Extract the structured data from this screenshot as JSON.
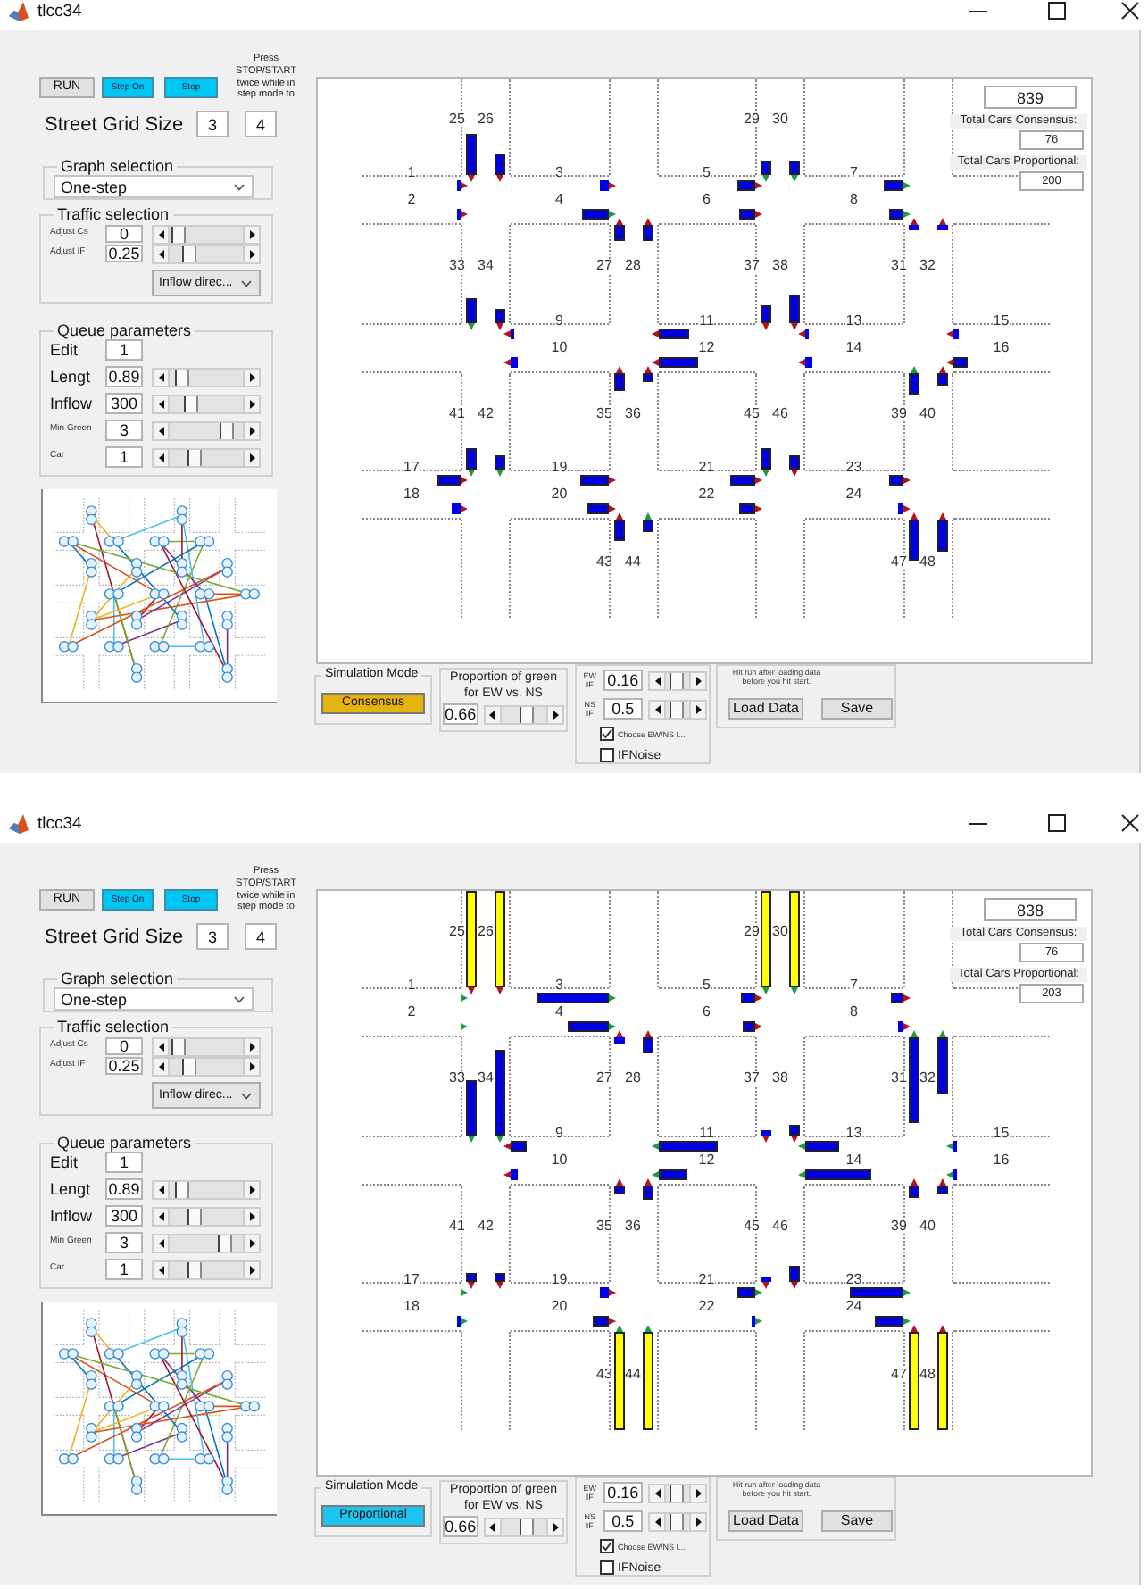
{
  "windows": [
    {
      "title": "tlcc34",
      "run_button": "RUN",
      "step_buttons": [
        "Step On",
        "Stop"
      ],
      "instruction": "Press STOP/START twice while in step mode to",
      "grid_size": {
        "label": "Street Grid Size",
        "rows": "3",
        "columns": "4"
      },
      "graph_selection": {
        "title": "Graph selection",
        "value": "One-step"
      },
      "traffic_selection": {
        "title": "Traffic selection",
        "rows": [
          {
            "label": "Adjust Cs",
            "value": "0",
            "level": 0.02
          },
          {
            "label": "Adjust IF",
            "value": "0.25",
            "level": 0.22
          }
        ],
        "direction": "Inflow direc..."
      },
      "queue_parameters": {
        "title": "Queue parameters",
        "rows": [
          {
            "kind": "edit",
            "label": "Edit",
            "value": "1"
          },
          {
            "kind": "slider",
            "label": "Lengt",
            "value": "0.89",
            "level": 0.08
          },
          {
            "kind": "slider",
            "label": "Inflow",
            "value": "300",
            "level": 0.25
          },
          {
            "kind": "minor",
            "label": "Min Green",
            "value": "3",
            "level": 0.85
          },
          {
            "kind": "minor",
            "label": "Car",
            "value": "1",
            "level": 0.3
          }
        ]
      },
      "street_map": {
        "counter": "839",
        "consensus_label": "Total Cars Consensus:",
        "consensus": "76",
        "proportional_label": "Total Cars Proportional:",
        "proportional": "200",
        "horizontal_roads": [
          {
            "segments": [
              {
                "lanes": [
                  {
                    "label": "1",
                    "queue": {
                      "level": 0.04,
                      "color": "#0000e6"
                    },
                    "signal": {
                      "color": "#b3141b"
                    }
                  },
                  {
                    "label": "2",
                    "queue": {
                      "level": 0.03,
                      "color": "#0000e6"
                    },
                    "signal": {
                      "color": "#b3141b"
                    }
                  }
                ]
              },
              {
                "lanes": [
                  {
                    "label": "3",
                    "queue": {
                      "level": 0.09,
                      "color": "#0000e6"
                    },
                    "signal": {
                      "color": "#b3141b"
                    }
                  },
                  {
                    "label": "4",
                    "queue": {
                      "level": 0.26,
                      "color": "#0000e6"
                    },
                    "signal": {
                      "color": "#1e9b3c"
                    }
                  }
                ]
              },
              {
                "lanes": [
                  {
                    "label": "5",
                    "queue": {
                      "level": 0.19,
                      "color": "#0000e6"
                    },
                    "signal": {
                      "color": "#b3141b"
                    }
                  },
                  {
                    "label": "6",
                    "queue": {
                      "level": 0.17,
                      "color": "#0000e6"
                    },
                    "signal": {
                      "color": "#b3141b"
                    }
                  }
                ]
              },
              {
                "lanes": [
                  {
                    "label": "7",
                    "queue": {
                      "level": 0.19,
                      "color": "#0000e6"
                    },
                    "signal": {
                      "color": "#1e9b3c"
                    }
                  },
                  {
                    "label": "8",
                    "queue": {
                      "level": 0.14,
                      "color": "#0000e6"
                    },
                    "signal": {
                      "color": "#1e9b3c"
                    }
                  }
                ]
              }
            ]
          },
          {
            "segments": [
              {
                "lanes": [
                  {
                    "label": "9",
                    "queue": {
                      "level": 0.03,
                      "color": "#0000e6"
                    },
                    "signal": {
                      "color": "#b3141b"
                    }
                  },
                  {
                    "label": "10",
                    "queue": {
                      "level": 0.07,
                      "color": "#0000e6"
                    },
                    "signal": {
                      "color": "#b3141b"
                    }
                  }
                ]
              },
              {
                "lanes": [
                  {
                    "label": "11",
                    "queue": {
                      "level": 0.32,
                      "color": "#0000e6"
                    },
                    "signal": {
                      "color": "#b3141b"
                    }
                  },
                  {
                    "label": "12",
                    "queue": {
                      "level": 0.41,
                      "color": "#0000e6"
                    },
                    "signal": {
                      "color": "#b3141b"
                    }
                  }
                ]
              },
              {
                "lanes": [
                  {
                    "label": "13",
                    "queue": {
                      "level": 0.04,
                      "color": "#0000e6"
                    },
                    "signal": {
                      "color": "#b3141b"
                    }
                  },
                  {
                    "label": "14",
                    "queue": {
                      "level": 0.08,
                      "color": "#0000e6"
                    },
                    "signal": {
                      "color": "#b3141b"
                    }
                  }
                ]
              },
              {
                "lanes": [
                  {
                    "label": "15",
                    "queue": {
                      "level": 0.06,
                      "color": "#0000e6"
                    },
                    "signal": {
                      "color": "#b3141b"
                    }
                  },
                  {
                    "label": "16",
                    "queue": {
                      "level": 0.15,
                      "color": "#0000e6"
                    },
                    "signal": {
                      "color": "#b3141b"
                    }
                  }
                ]
              }
            ]
          },
          {
            "segments": [
              {
                "lanes": [
                  {
                    "label": "17",
                    "queue": {
                      "level": 0.23,
                      "color": "#0000e6"
                    },
                    "signal": {
                      "color": "#b3141b"
                    }
                  },
                  {
                    "label": "18",
                    "queue": {
                      "level": 0.09,
                      "color": "#0000e6"
                    },
                    "signal": {
                      "color": "#b3141b"
                    }
                  }
                ]
              },
              {
                "lanes": [
                  {
                    "label": "19",
                    "queue": {
                      "level": 0.29,
                      "color": "#0000e6"
                    },
                    "signal": {
                      "color": "#b3141b"
                    }
                  },
                  {
                    "label": "20",
                    "queue": {
                      "level": 0.22,
                      "color": "#0000e6"
                    },
                    "signal": {
                      "color": "#b3141b"
                    }
                  }
                ]
              },
              {
                "lanes": [
                  {
                    "label": "21",
                    "queue": {
                      "level": 0.26,
                      "color": "#0000e6"
                    },
                    "signal": {
                      "color": "#b3141b"
                    }
                  },
                  {
                    "label": "22",
                    "queue": {
                      "level": 0.17,
                      "color": "#0000e6"
                    },
                    "signal": {
                      "color": "#b3141b"
                    }
                  }
                ]
              },
              {
                "lanes": [
                  {
                    "label": "23",
                    "queue": {
                      "level": 0.14,
                      "color": "#0000e6"
                    },
                    "signal": {
                      "color": "#b3141b"
                    }
                  },
                  {
                    "label": "24",
                    "queue": {
                      "level": 0.05,
                      "color": "#0000e6"
                    },
                    "signal": {
                      "color": "#b3141b"
                    }
                  }
                ]
              }
            ]
          }
        ],
        "vertical_roads": [
          {
            "segments": [
              {
                "lanes": [
                  {
                    "label": "25",
                    "queue": {
                      "level": 0.43,
                      "color": "#0000e6"
                    },
                    "signal": {
                      "color": "#b3141b"
                    }
                  },
                  {
                    "label": "26",
                    "queue": {
                      "level": 0.23,
                      "color": "#0000e6"
                    },
                    "signal": {
                      "color": "#b3141b"
                    }
                  }
                ]
              },
              {
                "lanes": [
                  {
                    "label": "33",
                    "queue": {
                      "level": 0.25,
                      "color": "#0000e6"
                    },
                    "signal": {
                      "color": "#1e9b3c"
                    }
                  },
                  {
                    "label": "34",
                    "queue": {
                      "level": 0.14,
                      "color": "#0000e6"
                    },
                    "signal": {
                      "color": "#b3141b"
                    }
                  }
                ]
              },
              {
                "lanes": [
                  {
                    "label": "41",
                    "queue": {
                      "level": 0.22,
                      "color": "#0000e6"
                    },
                    "signal": {
                      "color": "#1e9b3c"
                    }
                  },
                  {
                    "label": "42",
                    "queue": {
                      "level": 0.14,
                      "color": "#0000e6"
                    },
                    "signal": {
                      "color": "#1e9b3c"
                    }
                  }
                ]
              }
            ]
          },
          {
            "segments": [
              {
                "lanes": [
                  {
                    "label": "27",
                    "queue": {
                      "level": 0.17,
                      "color": "#0000e6"
                    },
                    "signal": {
                      "color": "#b3141b"
                    }
                  },
                  {
                    "label": "28",
                    "queue": {
                      "level": 0.16,
                      "color": "#0000e6"
                    },
                    "signal": {
                      "color": "#b3141b"
                    }
                  }
                ]
              },
              {
                "lanes": [
                  {
                    "label": "35",
                    "queue": {
                      "level": 0.19,
                      "color": "#0000e6"
                    },
                    "signal": {
                      "color": "#b3141b"
                    }
                  },
                  {
                    "label": "36",
                    "queue": {
                      "level": 0.11,
                      "color": "#0000e6"
                    },
                    "signal": {
                      "color": "#b3141b"
                    }
                  }
                ]
              },
              {
                "lanes": [
                  {
                    "label": "43",
                    "queue": {
                      "level": 0.22,
                      "color": "#0000e6"
                    },
                    "signal": {
                      "color": "#b3141b"
                    }
                  },
                  {
                    "label": "44",
                    "queue": {
                      "level": 0.12,
                      "color": "#0000e6"
                    },
                    "signal": {
                      "color": "#1e9b3c"
                    }
                  }
                ]
              }
            ]
          },
          {
            "segments": [
              {
                "lanes": [
                  {
                    "label": "29",
                    "queue": {
                      "level": 0.15,
                      "color": "#0000e6"
                    },
                    "signal": {
                      "color": "#1e9b3c"
                    }
                  },
                  {
                    "label": "30",
                    "queue": {
                      "level": 0.15,
                      "color": "#0000e6"
                    },
                    "signal": {
                      "color": "#1e9b3c"
                    }
                  }
                ]
              },
              {
                "lanes": [
                  {
                    "label": "37",
                    "queue": {
                      "level": 0.17,
                      "color": "#0000e6"
                    },
                    "signal": {
                      "color": "#b3141b"
                    }
                  },
                  {
                    "label": "38",
                    "queue": {
                      "level": 0.29,
                      "color": "#0000e6"
                    },
                    "signal": {
                      "color": "#b3141b"
                    }
                  }
                ]
              },
              {
                "lanes": [
                  {
                    "label": "45",
                    "queue": {
                      "level": 0.22,
                      "color": "#0000e6"
                    },
                    "signal": {
                      "color": "#1e9b3c"
                    }
                  },
                  {
                    "label": "46",
                    "queue": {
                      "level": 0.15,
                      "color": "#0000e6"
                    },
                    "signal": {
                      "color": "#b3141b"
                    }
                  }
                ]
              }
            ]
          },
          {
            "segments": [
              {
                "lanes": [
                  {
                    "label": "31",
                    "queue": {
                      "level": 0.06,
                      "color": "#0000e6"
                    },
                    "signal": {
                      "color": "#b3141b"
                    }
                  },
                  {
                    "label": "32",
                    "queue": {
                      "level": 0.06,
                      "color": "#0000e6"
                    },
                    "signal": {
                      "color": "#b3141b"
                    }
                  }
                ]
              },
              {
                "lanes": [
                  {
                    "label": "39",
                    "queue": {
                      "level": 0.23,
                      "color": "#0000e6"
                    },
                    "signal": {
                      "color": "#1e9b3c"
                    }
                  },
                  {
                    "label": "40",
                    "queue": {
                      "level": 0.14,
                      "color": "#0000e6"
                    },
                    "signal": {
                      "color": "#b3141b"
                    }
                  }
                ]
              },
              {
                "lanes": [
                  {
                    "label": "47",
                    "queue": {
                      "level": 0.42,
                      "color": "#0000e6"
                    },
                    "signal": {
                      "color": "#b3141b"
                    }
                  },
                  {
                    "label": "48",
                    "queue": {
                      "level": 0.32,
                      "color": "#0000e6"
                    },
                    "signal": {
                      "color": "#b3141b"
                    }
                  }
                ]
              }
            ]
          }
        ]
      },
      "simulation_mode": {
        "title": "Simulation Mode",
        "button": {
          "label": "Consensus",
          "color": "#e6b20c"
        }
      },
      "green_proportion": {
        "label": "Proportion of green for EW vs. NS",
        "value": "0.66",
        "level": 0.6
      },
      "inflow": {
        "rows": [
          {
            "label": "EW IF",
            "value": "0.16",
            "level": 0.35
          },
          {
            "label": "NS IF",
            "value": "0.5",
            "level": 0.4
          }
        ],
        "checkboxes": [
          {
            "kind": "minor",
            "label": "Choose EW/NS I...",
            "checked": true
          },
          {
            "kind": "main",
            "label": "IFNoise",
            "checked": false
          }
        ]
      },
      "data": {
        "hint": "Hit run after loading data before you hit start.",
        "buttons": [
          "Load Data",
          "Save"
        ]
      }
    },
    {
      "title": "tlcc34",
      "run_button": "RUN",
      "step_buttons": [
        "Step On",
        "Stop"
      ],
      "instruction": "Press STOP/START twice while in step mode to",
      "grid_size": {
        "label": "Street Grid Size",
        "rows": "3",
        "columns": "4"
      },
      "graph_selection": {
        "title": "Graph selection",
        "value": "One-step"
      },
      "traffic_selection": {
        "title": "Traffic selection",
        "rows": [
          {
            "label": "Adjust Cs",
            "value": "0",
            "level": 0.02
          },
          {
            "label": "Adjust IF",
            "value": "0.25",
            "level": 0.22
          }
        ],
        "direction": "Inflow direc..."
      },
      "queue_parameters": {
        "title": "Queue parameters",
        "rows": [
          {
            "kind": "edit",
            "label": "Edit",
            "value": "1"
          },
          {
            "kind": "slider",
            "label": "Lengt",
            "value": "0.89",
            "level": 0.1
          },
          {
            "kind": "slider",
            "label": "Inflow",
            "value": "300",
            "level": 0.3
          },
          {
            "kind": "minor",
            "label": "Min Green",
            "value": "3",
            "level": 0.82
          },
          {
            "kind": "minor",
            "label": "Car",
            "value": "1",
            "level": 0.3
          }
        ]
      },
      "street_map": {
        "counter": "838",
        "consensus_label": "Total Cars Consensus:",
        "consensus": "76",
        "proportional_label": "Total Cars Proportional:",
        "proportional": "203",
        "horizontal_roads": [
          {
            "segments": [
              {
                "lanes": [
                  {
                    "label": "1",
                    "signal": {
                      "color": "#1e9b3c"
                    }
                  },
                  {
                    "label": "2",
                    "signal": {
                      "color": "#1e9b3c"
                    }
                  }
                ]
              },
              {
                "lanes": [
                  {
                    "label": "3",
                    "queue": {
                      "level": 0.73,
                      "color": "#0000e6"
                    },
                    "signal": {
                      "color": "#1e9b3c"
                    }
                  },
                  {
                    "label": "4",
                    "queue": {
                      "level": 0.42,
                      "color": "#0000e6"
                    },
                    "signal": {
                      "color": "#1e9b3c"
                    }
                  }
                ]
              },
              {
                "lanes": [
                  {
                    "label": "5",
                    "queue": {
                      "level": 0.15,
                      "color": "#0000e6"
                    },
                    "signal": {
                      "color": "#b3141b"
                    }
                  },
                  {
                    "label": "6",
                    "queue": {
                      "level": 0.12,
                      "color": "#0000e6"
                    },
                    "signal": {
                      "color": "#b3141b"
                    }
                  }
                ]
              },
              {
                "lanes": [
                  {
                    "label": "7",
                    "queue": {
                      "level": 0.12,
                      "color": "#0000e6"
                    },
                    "signal": {
                      "color": "#b3141b"
                    }
                  },
                  {
                    "label": "8",
                    "queue": {
                      "level": 0.05,
                      "color": "#0000e6"
                    },
                    "signal": {
                      "color": "#b3141b"
                    }
                  }
                ]
              }
            ]
          },
          {
            "segments": [
              {
                "lanes": [
                  {
                    "label": "9",
                    "queue": {
                      "level": 0.17,
                      "color": "#0000e6"
                    },
                    "signal": {
                      "color": "#b3141b"
                    }
                  },
                  {
                    "label": "10",
                    "queue": {
                      "level": 0.08,
                      "color": "#0000e6"
                    },
                    "signal": {
                      "color": "#b3141b"
                    }
                  }
                ]
              },
              {
                "lanes": [
                  {
                    "label": "11",
                    "queue": {
                      "level": 0.61,
                      "color": "#0000e6"
                    },
                    "signal": {
                      "color": "#1e9b3c"
                    }
                  },
                  {
                    "label": "12",
                    "queue": {
                      "level": 0.3,
                      "color": "#0000e6"
                    },
                    "signal": {
                      "color": "#1e9b3c"
                    }
                  }
                ]
              },
              {
                "lanes": [
                  {
                    "label": "13",
                    "queue": {
                      "level": 0.35,
                      "color": "#0000e6"
                    },
                    "signal": {
                      "color": "#1e9b3c"
                    }
                  },
                  {
                    "label": "14",
                    "queue": {
                      "level": 0.68,
                      "color": "#0000e6"
                    },
                    "signal": {
                      "color": "#1e9b3c"
                    }
                  }
                ]
              },
              {
                "lanes": [
                  {
                    "label": "15",
                    "queue": {
                      "level": 0.04,
                      "color": "#0000e6"
                    },
                    "signal": {
                      "color": "#1e9b3c"
                    }
                  },
                  {
                    "label": "16",
                    "queue": {
                      "level": 0.04,
                      "color": "#0000e6"
                    },
                    "signal": {
                      "color": "#1e9b3c"
                    }
                  }
                ]
              }
            ]
          },
          {
            "segments": [
              {
                "lanes": [
                  {
                    "label": "17",
                    "signal": {
                      "color": "#1e9b3c"
                    }
                  },
                  {
                    "label": "18",
                    "queue": {
                      "level": 0.04,
                      "color": "#0000e6"
                    },
                    "signal": {
                      "color": "#1e9b3c"
                    }
                  }
                ]
              },
              {
                "lanes": [
                  {
                    "label": "19",
                    "queue": {
                      "level": 0.09,
                      "color": "#0000e6"
                    },
                    "signal": {
                      "color": "#b3141b"
                    }
                  },
                  {
                    "label": "20",
                    "queue": {
                      "level": 0.16,
                      "color": "#0000e6"
                    },
                    "signal": {
                      "color": "#b3141b"
                    }
                  }
                ]
              },
              {
                "lanes": [
                  {
                    "label": "21",
                    "queue": {
                      "level": 0.18,
                      "color": "#0000e6"
                    },
                    "signal": {
                      "color": "#1e9b3c"
                    }
                  },
                  {
                    "label": "22",
                    "queue": {
                      "level": 0.04,
                      "color": "#0000e6"
                    },
                    "signal": {
                      "color": "#1e9b3c"
                    }
                  }
                ]
              },
              {
                "lanes": [
                  {
                    "label": "23",
                    "queue": {
                      "level": 0.55,
                      "color": "#0000e6"
                    },
                    "signal": {
                      "color": "#1e9b3c"
                    }
                  },
                  {
                    "label": "24",
                    "queue": {
                      "level": 0.28,
                      "color": "#0000e6"
                    },
                    "signal": {
                      "color": "#1e9b3c"
                    }
                  }
                ]
              }
            ]
          }
        ],
        "vertical_roads": [
          {
            "segments": [
              {
                "lanes": [
                  {
                    "label": "25",
                    "queue": {
                      "level": 1,
                      "color": "#ffff00"
                    },
                    "signal": {
                      "color": "#b3141b"
                    }
                  },
                  {
                    "label": "26",
                    "queue": {
                      "level": 1,
                      "color": "#ffff00"
                    },
                    "signal": {
                      "color": "#b3141b"
                    }
                  }
                ]
              },
              {
                "lanes": [
                  {
                    "label": "33",
                    "queue": {
                      "level": 0.56,
                      "color": "#0000e6"
                    },
                    "signal": {
                      "color": "#1e9b3c"
                    }
                  },
                  {
                    "label": "34",
                    "queue": {
                      "level": 0.87,
                      "color": "#0000e6"
                    },
                    "signal": {
                      "color": "#1e9b3c"
                    }
                  }
                ]
              },
              {
                "lanes": [
                  {
                    "label": "41",
                    "queue": {
                      "level": 0.1,
                      "color": "#0000e6"
                    },
                    "signal": {
                      "color": "#b3141b"
                    }
                  },
                  {
                    "label": "42",
                    "queue": {
                      "level": 0.1,
                      "color": "#0000e6"
                    },
                    "signal": {
                      "color": "#b3141b"
                    }
                  }
                ]
              }
            ]
          },
          {
            "segments": [
              {
                "lanes": [
                  {
                    "label": "27",
                    "queue": {
                      "level": 0.08,
                      "color": "#0000e6"
                    },
                    "signal": {
                      "color": "#b3141b"
                    }
                  },
                  {
                    "label": "28",
                    "queue": {
                      "level": 0.17,
                      "color": "#0000e6"
                    },
                    "signal": {
                      "color": "#b3141b"
                    }
                  }
                ]
              },
              {
                "lanes": [
                  {
                    "label": "35",
                    "queue": {
                      "level": 0.11,
                      "color": "#0000e6"
                    },
                    "signal": {
                      "color": "#b3141b"
                    }
                  },
                  {
                    "label": "36",
                    "queue": {
                      "level": 0.15,
                      "color": "#0000e6"
                    },
                    "signal": {
                      "color": "#b3141b"
                    }
                  }
                ]
              },
              {
                "lanes": [
                  {
                    "label": "43",
                    "queue": {
                      "level": 1,
                      "color": "#ffff00"
                    },
                    "signal": {
                      "color": "#1e9b3c"
                    }
                  },
                  {
                    "label": "44",
                    "queue": {
                      "level": 1,
                      "color": "#ffff00"
                    },
                    "signal": {
                      "color": "#1e9b3c"
                    }
                  }
                ]
              }
            ]
          },
          {
            "segments": [
              {
                "lanes": [
                  {
                    "label": "29",
                    "queue": {
                      "level": 1,
                      "color": "#ffff00"
                    },
                    "signal": {
                      "color": "#1e9b3c"
                    }
                  },
                  {
                    "label": "30",
                    "queue": {
                      "level": 1,
                      "color": "#ffff00"
                    },
                    "signal": {
                      "color": "#1e9b3c"
                    }
                  }
                ]
              },
              {
                "lanes": [
                  {
                    "label": "37",
                    "queue": {
                      "level": 0.04,
                      "color": "#0000e6"
                    },
                    "signal": {
                      "color": "#b3141b"
                    }
                  },
                  {
                    "label": "38",
                    "queue": {
                      "level": 0.1,
                      "color": "#0000e6"
                    },
                    "signal": {
                      "color": "#b3141b"
                    }
                  }
                ]
              },
              {
                "lanes": [
                  {
                    "label": "45",
                    "queue": {
                      "level": 0.06,
                      "color": "#0000e6"
                    },
                    "signal": {
                      "color": "#b3141b"
                    }
                  },
                  {
                    "label": "46",
                    "queue": {
                      "level": 0.16,
                      "color": "#0000e6"
                    },
                    "signal": {
                      "color": "#b3141b"
                    }
                  }
                ]
              }
            ]
          },
          {
            "segments": [
              {
                "lanes": [
                  {
                    "label": "31",
                    "queue": {
                      "level": 0.88,
                      "color": "#0000e6"
                    },
                    "signal": {
                      "color": "#1e9b3c"
                    }
                  },
                  {
                    "label": "32",
                    "queue": {
                      "level": 0.58,
                      "color": "#0000e6"
                    },
                    "signal": {
                      "color": "#1e9b3c"
                    }
                  }
                ]
              },
              {
                "lanes": [
                  {
                    "label": "39",
                    "queue": {
                      "level": 0.14,
                      "color": "#0000e6"
                    },
                    "signal": {
                      "color": "#b3141b"
                    }
                  },
                  {
                    "label": "40",
                    "queue": {
                      "level": 0.11,
                      "color": "#0000e6"
                    },
                    "signal": {
                      "color": "#b3141b"
                    }
                  }
                ]
              },
              {
                "lanes": [
                  {
                    "label": "47",
                    "queue": {
                      "level": 1,
                      "color": "#ffff00"
                    },
                    "signal": {
                      "color": "#b3141b"
                    }
                  },
                  {
                    "label": "48",
                    "queue": {
                      "level": 1,
                      "color": "#ffff00"
                    },
                    "signal": {
                      "color": "#b3141b"
                    }
                  }
                ]
              }
            ]
          }
        ]
      },
      "simulation_mode": {
        "title": "Simulation Mode",
        "button": {
          "label": "Proportional",
          "color": "#1cc4f0"
        }
      },
      "green_proportion": {
        "label": "Proportion of green for EW vs. NS",
        "value": "0.66",
        "level": 0.6
      },
      "inflow": {
        "rows": [
          {
            "label": "EW IF",
            "value": "0.16",
            "level": 0.35
          },
          {
            "label": "NS IF",
            "value": "0.5",
            "level": 0.4
          }
        ],
        "checkboxes": [
          {
            "kind": "minor",
            "label": "Choose EW/NS I...",
            "checked": true
          },
          {
            "kind": "main",
            "label": "IFNoise",
            "checked": false
          }
        ]
      },
      "data": {
        "hint": "Hit run after loading data before you hit start.",
        "buttons": [
          "Load Data",
          "Save"
        ]
      }
    }
  ]
}
